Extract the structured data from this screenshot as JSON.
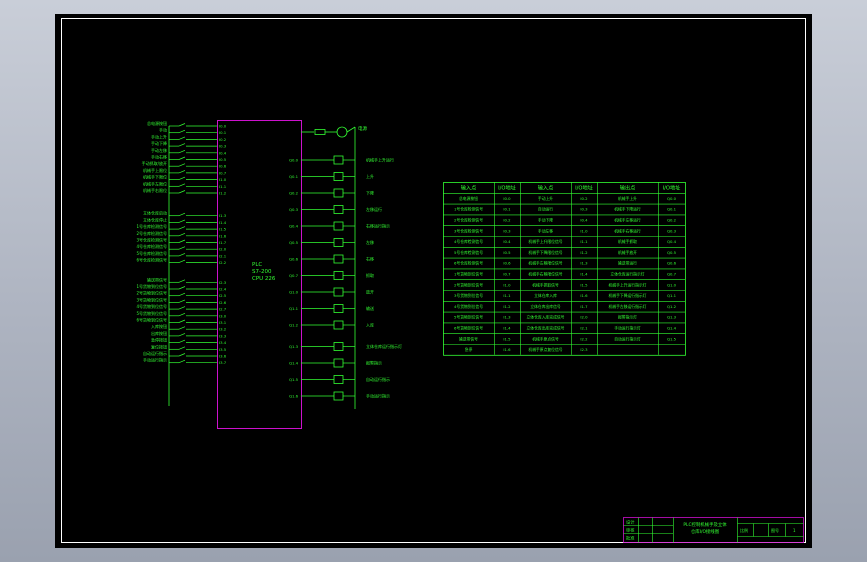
{
  "plc": {
    "line1": "PLC",
    "line2": "S7-200",
    "line3": "CPU 226"
  },
  "power_label": "电源",
  "inputs": [
    {
      "label": "总电源按钮",
      "addr": "I0.0"
    },
    {
      "label": "手动",
      "addr": "I0.1"
    },
    {
      "label": "手动上升",
      "addr": "I0.2"
    },
    {
      "label": "手动下降",
      "addr": "I0.3"
    },
    {
      "label": "手动左移",
      "addr": "I0.4"
    },
    {
      "label": "手动右移",
      "addr": "I0.5"
    },
    {
      "label": "手动抓取/放开",
      "addr": "I0.6"
    },
    {
      "label": "机械手上限位",
      "addr": "I0.7"
    },
    {
      "label": "机械手下限位",
      "addr": "I1.0"
    },
    {
      "label": "机械手左限位",
      "addr": "I1.1"
    },
    {
      "label": "机械手右限位",
      "addr": "I1.2"
    },
    {
      "label": "立体仓库启动",
      "addr": "I1.3"
    },
    {
      "label": "立体仓库停止",
      "addr": "I1.4"
    },
    {
      "label": "1号仓库检测信号",
      "addr": "I1.5"
    },
    {
      "label": "2号仓库检测信号",
      "addr": "I1.6"
    },
    {
      "label": "3号仓库检测信号",
      "addr": "I1.7"
    },
    {
      "label": "4号仓库检测信号",
      "addr": "I2.0"
    },
    {
      "label": "5号仓库检测信号",
      "addr": "I2.1"
    },
    {
      "label": "6号仓库检测信号",
      "addr": "I2.2"
    },
    {
      "label": "输送带信号",
      "addr": "I2.3"
    },
    {
      "label": "1号货物到位信号",
      "addr": "I2.4"
    },
    {
      "label": "2号货物到位信号",
      "addr": "I2.5"
    },
    {
      "label": "3号货物到位信号",
      "addr": "I2.6"
    },
    {
      "label": "4号货物到位信号",
      "addr": "I2.7"
    },
    {
      "label": "5号货物到位信号",
      "addr": "I3.0"
    },
    {
      "label": "6号货物到位信号",
      "addr": "I3.1"
    },
    {
      "label": "入库按钮",
      "addr": "I3.2"
    },
    {
      "label": "出库按钮",
      "addr": "I3.3"
    },
    {
      "label": "急停按钮",
      "addr": "I3.4"
    },
    {
      "label": "复位按钮",
      "addr": "I3.5"
    },
    {
      "label": "自动运行指示",
      "addr": "I3.6"
    },
    {
      "label": "手动运行指示",
      "addr": "I3.7"
    }
  ],
  "outputs": [
    {
      "label": "机械手上升运行",
      "addr": "Q0.0"
    },
    {
      "label": "上升",
      "addr": "Q0.1"
    },
    {
      "label": "下降",
      "addr": "Q0.2"
    },
    {
      "label": "左移运行",
      "addr": "Q0.3"
    },
    {
      "label": "右移运行指示",
      "addr": "Q0.4"
    },
    {
      "label": "左移",
      "addr": "Q0.5"
    },
    {
      "label": "右移",
      "addr": "Q0.6"
    },
    {
      "label": "抓取",
      "addr": "Q0.7"
    },
    {
      "label": "放开",
      "addr": "Q1.0"
    },
    {
      "label": "输送",
      "addr": "Q1.1"
    },
    {
      "label": "入库",
      "addr": "Q1.2"
    },
    {
      "label": "立体仓库运行指示灯",
      "addr": "Q1.3"
    },
    {
      "label": "报警指示",
      "addr": "Q1.4"
    },
    {
      "label": "自动运行指示",
      "addr": "Q1.5"
    },
    {
      "label": "手动运行指示",
      "addr": "Q1.6"
    }
  ],
  "io_table": {
    "headers": [
      "输入点",
      "I/O地址",
      "输入点",
      "I/O地址",
      "输出点",
      "I/O地址"
    ],
    "rows": [
      [
        "总电源按钮",
        "I0.0",
        "手动上升",
        "I0.2",
        "机械手上升",
        "Q0.0"
      ],
      [
        "1号仓库检测信号",
        "I0.1",
        "自动运行",
        "I0.3",
        "机械手下降运行",
        "Q0.1"
      ],
      [
        "2号仓库检测信号",
        "I0.2",
        "手动下降",
        "I0.4",
        "机械手左移运行",
        "Q0.2"
      ],
      [
        "3号仓库检测信号",
        "I0.3",
        "手动左移",
        "I1.0",
        "机械手右移运行",
        "Q0.3"
      ],
      [
        "4号仓库检测信号",
        "I0.4",
        "机械手上升限位信号",
        "I1.1",
        "机械手抓取",
        "Q0.4"
      ],
      [
        "5号仓库检测信号",
        "I0.5",
        "机械手下降限位信号",
        "I1.2",
        "机械手放开",
        "Q0.5"
      ],
      [
        "6号仓库检测信号",
        "I0.6",
        "机械手左移限位信号",
        "I1.3",
        "输送带运行",
        "Q0.6"
      ],
      [
        "1号货物到位信号",
        "I0.7",
        "机械手右移限位信号",
        "I1.4",
        "立体仓库运行指示灯",
        "Q0.7"
      ],
      [
        "2号货物到位信号",
        "I1.0",
        "机械手抓取信号",
        "I1.5",
        "机械手上升运行指示灯",
        "Q1.0"
      ],
      [
        "3号货物到位信号",
        "I1.1",
        "立体仓库入库",
        "I1.6",
        "机械手下降运行指示灯",
        "Q1.1"
      ],
      [
        "4号货物到位信号",
        "I1.2",
        "立体仓库出库信号",
        "I1.7",
        "机械手左移运行指示灯",
        "Q1.2"
      ],
      [
        "5号货物到位信号",
        "I1.3",
        "立体仓库入库完成信号",
        "I2.0",
        "报警指示灯",
        "Q1.3"
      ],
      [
        "6号货物到位信号",
        "I1.4",
        "立体仓库出库完成信号",
        "I2.1",
        "手动运行指示灯",
        "Q1.4"
      ],
      [
        "输送带信号",
        "I1.5",
        "机械手原点信号",
        "I2.2",
        "自动运行指示灯",
        "Q1.5"
      ],
      [
        "急停",
        "I1.6",
        "机械手原点复位信号",
        "I2.3",
        "",
        ""
      ]
    ]
  },
  "title_block": {
    "labels": [
      "设计",
      "审核",
      "批准"
    ],
    "title_line1": "PLC控制机械手及立体",
    "title_line2": "仓库I/O接线图",
    "scale_label": "比例",
    "sheet_label": "图号",
    "sheet_no": "1"
  },
  "colors": {
    "wire": "#33ff33",
    "plc_box": "#cc11cc",
    "background": "#000000",
    "frame": "#ffffff"
  }
}
